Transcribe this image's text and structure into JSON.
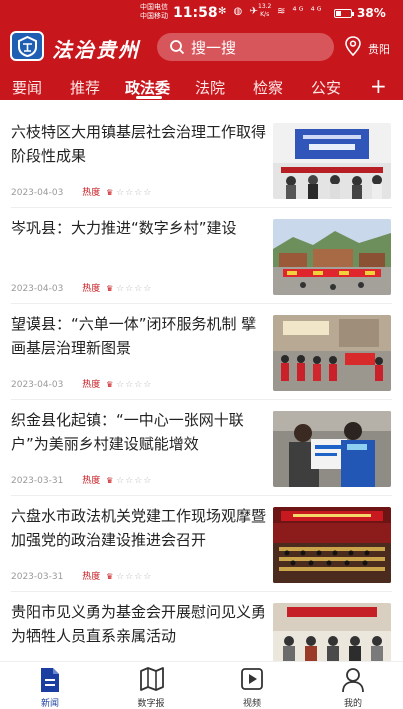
{
  "status_bar": {
    "carrier_1": "中国电信",
    "carrier_2": "中国移动",
    "time": "11:58",
    "icons": "✻ ◍ ✈",
    "speed_value": "13.2",
    "speed_unit": "K/s",
    "network_icons": "≋ ⁴ᴳ ⁴ᴳ",
    "battery_percent": "38%",
    "battery_level": 0.38
  },
  "header": {
    "logo_text": "法治贵州",
    "search_placeholder": "搜一搜",
    "location": "贵阳"
  },
  "tabs": [
    {
      "label": "要闻",
      "active": false
    },
    {
      "label": "推荐",
      "active": false
    },
    {
      "label": "政法委",
      "active": true
    },
    {
      "label": "法院",
      "active": false
    },
    {
      "label": "检察",
      "active": false
    },
    {
      "label": "公安",
      "active": false
    }
  ],
  "tab_plus": "+",
  "heat_label": "热度",
  "crown_icon": "♛",
  "stars_icon": "☆☆☆☆",
  "news": [
    {
      "title": "六枝特区大用镇基层社会治理工作取得阶段性成果",
      "date": "2023-04-03"
    },
    {
      "title": "岑巩县：大力推进“数字乡村”建设",
      "date": "2023-04-03"
    },
    {
      "title": "望谟县：“六单一体”闭环服务机制 擘画基层治理新图景",
      "date": "2023-04-03"
    },
    {
      "title": "织金县化起镇：“一中心一张网十联户”为美丽乡村建设赋能增效",
      "date": "2023-03-31"
    },
    {
      "title": "六盘水市政法机关党建工作现场观摩暨加强党的政治建设推进会召开",
      "date": "2023-03-31"
    },
    {
      "title": "贵阳市见义勇为基金会开展慰问见义勇为牺牲人员直系亲属活动",
      "date": ""
    }
  ],
  "bottom_nav": [
    {
      "label": "新闻",
      "icon": "document-icon",
      "active": true
    },
    {
      "label": "数字报",
      "icon": "map-icon",
      "active": false
    },
    {
      "label": "视频",
      "icon": "play-icon",
      "active": false
    },
    {
      "label": "我的",
      "icon": "user-icon",
      "active": false
    }
  ],
  "colors": {
    "brand_red": "#c8161d",
    "nav_active": "#1b3fa0",
    "logo_blue": "#1f5fb3"
  }
}
